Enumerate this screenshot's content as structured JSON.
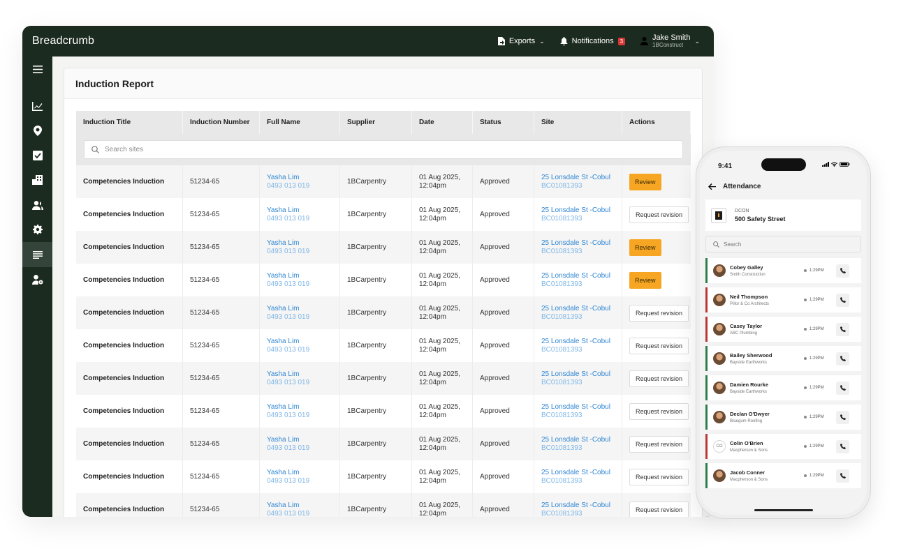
{
  "app": {
    "brand": "Breadcrumb",
    "exports_label": "Exports",
    "notifications_label": "Notifications",
    "notifications_count": "3",
    "user_name": "Jake Smith",
    "user_org": "1BConstruct"
  },
  "sidebar": {
    "icons": [
      "menu-icon",
      "chart-icon",
      "location-pin-icon",
      "checkbox-icon",
      "building-icon",
      "users-icon",
      "gear-icon",
      "report-lines-icon",
      "user-settings-icon"
    ],
    "active": "report-lines-icon"
  },
  "report": {
    "title": "Induction Report",
    "columns": [
      "Induction Title",
      "Induction Number",
      "Full Name",
      "Supplier",
      "Date",
      "Status",
      "Site",
      "Actions"
    ],
    "search_placeholder": "Search sites",
    "rows": [
      {
        "title": "Competencies Induction",
        "number": "51234-65",
        "name": "Yasha Lim",
        "phone": "0493 013 019",
        "supplier": "1BCarpentry",
        "date": "01 Aug 2025,",
        "time": "12:04pm",
        "status": "Approved",
        "site": "25 Lonsdale St -Cobul",
        "site_code": "BC01081393",
        "action": "Review"
      },
      {
        "title": "Competencies Induction",
        "number": "51234-65",
        "name": "Yasha Lim",
        "phone": "0493 013 019",
        "supplier": "1BCarpentry",
        "date": "01 Aug 2025,",
        "time": "12:04pm",
        "status": "Approved",
        "site": "25 Lonsdale St -Cobul",
        "site_code": "BC01081393",
        "action": "Request revision"
      },
      {
        "title": "Competencies Induction",
        "number": "51234-65",
        "name": "Yasha Lim",
        "phone": "0493 013 019",
        "supplier": "1BCarpentry",
        "date": "01 Aug 2025,",
        "time": "12:04pm",
        "status": "Approved",
        "site": "25 Lonsdale St -Cobul",
        "site_code": "BC01081393",
        "action": "Review"
      },
      {
        "title": "Competencies Induction",
        "number": "51234-65",
        "name": "Yasha Lim",
        "phone": "0493 013 019",
        "supplier": "1BCarpentry",
        "date": "01 Aug 2025,",
        "time": "12:04pm",
        "status": "Approved",
        "site": "25 Lonsdale St -Cobul",
        "site_code": "BC01081393",
        "action": "Review"
      },
      {
        "title": "Competencies Induction",
        "number": "51234-65",
        "name": "Yasha Lim",
        "phone": "0493 013 019",
        "supplier": "1BCarpentry",
        "date": "01 Aug 2025,",
        "time": "12:04pm",
        "status": "Approved",
        "site": "25 Lonsdale St -Cobul",
        "site_code": "BC01081393",
        "action": "Request revision"
      },
      {
        "title": "Competencies Induction",
        "number": "51234-65",
        "name": "Yasha Lim",
        "phone": "0493 013 019",
        "supplier": "1BCarpentry",
        "date": "01 Aug 2025,",
        "time": "12:04pm",
        "status": "Approved",
        "site": "25 Lonsdale St -Cobul",
        "site_code": "BC01081393",
        "action": "Request revision"
      },
      {
        "title": "Competencies Induction",
        "number": "51234-65",
        "name": "Yasha Lim",
        "phone": "0493 013 019",
        "supplier": "1BCarpentry",
        "date": "01 Aug 2025,",
        "time": "12:04pm",
        "status": "Approved",
        "site": "25 Lonsdale St -Cobul",
        "site_code": "BC01081393",
        "action": "Request revision"
      },
      {
        "title": "Competencies Induction",
        "number": "51234-65",
        "name": "Yasha Lim",
        "phone": "0493 013 019",
        "supplier": "1BCarpentry",
        "date": "01 Aug 2025,",
        "time": "12:04pm",
        "status": "Approved",
        "site": "25 Lonsdale St -Cobul",
        "site_code": "BC01081393",
        "action": "Request revision"
      },
      {
        "title": "Competencies Induction",
        "number": "51234-65",
        "name": "Yasha Lim",
        "phone": "0493 013 019",
        "supplier": "1BCarpentry",
        "date": "01 Aug 2025,",
        "time": "12:04pm",
        "status": "Approved",
        "site": "25 Lonsdale St -Cobul",
        "site_code": "BC01081393",
        "action": "Request revision"
      },
      {
        "title": "Competencies Induction",
        "number": "51234-65",
        "name": "Yasha Lim",
        "phone": "0493 013 019",
        "supplier": "1BCarpentry",
        "date": "01 Aug 2025,",
        "time": "12:04pm",
        "status": "Approved",
        "site": "25 Lonsdale St -Cobul",
        "site_code": "BC01081393",
        "action": "Request revision"
      },
      {
        "title": "Competencies Induction",
        "number": "51234-65",
        "name": "Yasha Lim",
        "phone": "0493 013 019",
        "supplier": "1BCarpentry",
        "date": "01 Aug 2025,",
        "time": "12:04pm",
        "status": "Approved",
        "site": "25 Lonsdale St -Cobul",
        "site_code": "BC01081393",
        "action": "Request revision"
      }
    ]
  },
  "phone": {
    "time": "9:41",
    "header": "Attendance",
    "site_code": "DCON",
    "site_name": "500 Safety Street",
    "search_placeholder": "Search",
    "people": [
      {
        "name": "Cobey Galley",
        "org": "Smith Construction",
        "time": "1:29PM",
        "status": "green",
        "initials": ""
      },
      {
        "name": "Neil Thompson",
        "org": "Pillor & Co Architects",
        "time": "1:29PM",
        "status": "red",
        "initials": ""
      },
      {
        "name": "Casey Taylor",
        "org": "ABC Plumbing",
        "time": "1:29PM",
        "status": "red",
        "initials": ""
      },
      {
        "name": "Bailey Sherwood",
        "org": "Bayside Earthworks",
        "time": "1:29PM",
        "status": "green",
        "initials": ""
      },
      {
        "name": "Damien Rourke",
        "org": "Bayside Earthworks",
        "time": "1:29PM",
        "status": "green",
        "initials": ""
      },
      {
        "name": "Declan O'Dwyer",
        "org": "Bluegum Roofing",
        "time": "1:29PM",
        "status": "green",
        "initials": ""
      },
      {
        "name": "Colin O'Brien",
        "org": "Macpherson & Sons",
        "time": "1:29PM",
        "status": "red",
        "initials": "CO"
      },
      {
        "name": "Jacob Conner",
        "org": "Macpherson & Sons",
        "time": "1:29PM",
        "status": "green",
        "initials": ""
      }
    ]
  },
  "colors": {
    "app_bg": "#1c2b1f",
    "review_button": "#f6a623",
    "link": "#2f86d3",
    "status_green": "#2e7d4a",
    "status_red": "#b93838"
  }
}
